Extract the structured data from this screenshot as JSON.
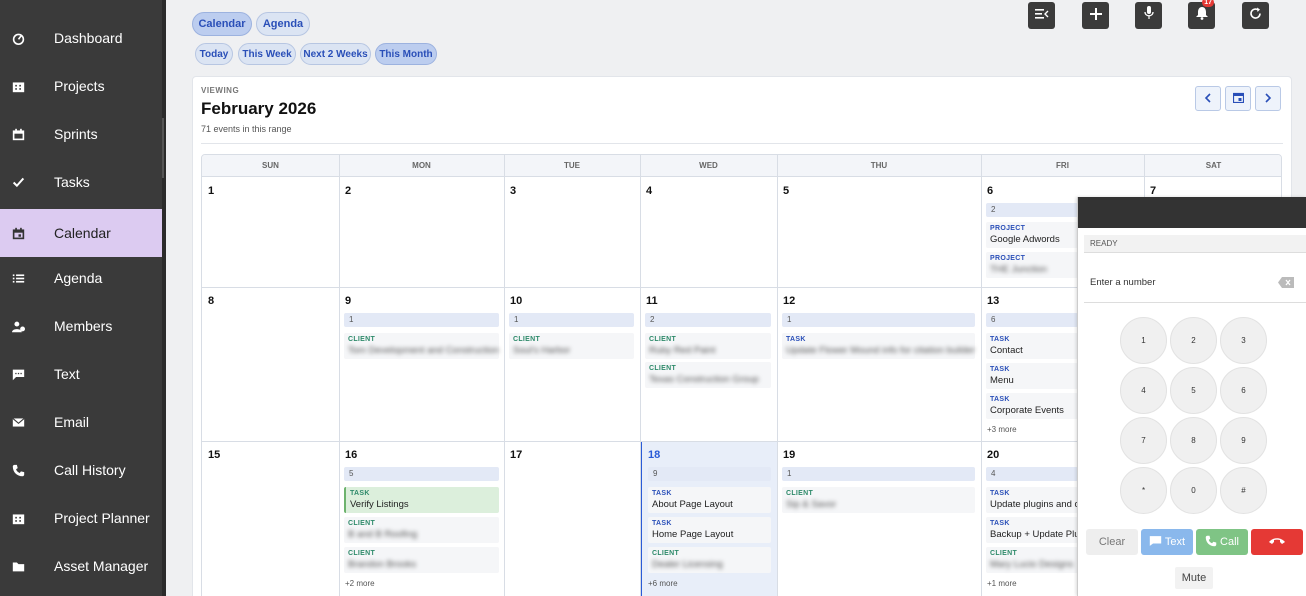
{
  "sidebar": {
    "items": [
      {
        "label": "Dashboard",
        "icon": "gauge-icon"
      },
      {
        "label": "Projects",
        "icon": "building-icon"
      },
      {
        "label": "Sprints",
        "icon": "calendar-icon"
      },
      {
        "label": "Tasks",
        "icon": "check-icon"
      },
      {
        "label": "Calendar",
        "icon": "calendar-day-icon",
        "active": true
      },
      {
        "label": "Agenda",
        "icon": "list-icon"
      },
      {
        "label": "Members",
        "icon": "members-icon"
      },
      {
        "label": "Text",
        "icon": "chat-icon"
      },
      {
        "label": "Email",
        "icon": "envelope-icon"
      },
      {
        "label": "Call History",
        "icon": "phone-icon"
      },
      {
        "label": "Project Planner",
        "icon": "building-icon"
      },
      {
        "label": "Asset Manager",
        "icon": "folder-icon"
      }
    ]
  },
  "view_tabs": {
    "calendar": "Calendar",
    "agenda": "Agenda"
  },
  "range_tabs": {
    "today": "Today",
    "this_week": "This Week",
    "next_2_weeks": "Next 2 Weeks",
    "this_month": "This Month"
  },
  "toolbar": {
    "notification_count": "17"
  },
  "header": {
    "viewing": "VIEWING",
    "month": "February 2026",
    "range": "71 events in this range"
  },
  "calendar": {
    "days_of_week": [
      "SUN",
      "MON",
      "TUE",
      "WED",
      "THU",
      "FRI",
      "SAT"
    ],
    "week1": {
      "d1": "1",
      "d2": "2",
      "d3": "3",
      "d4": "4",
      "d5": "5",
      "d6": "6",
      "d7": "7",
      "fri_count": "2",
      "fri_ev1_type": "PROJECT",
      "fri_ev1_name": "Google Adwords",
      "fri_ev2_type": "PROJECT",
      "fri_ev2_name": "THE Junction"
    },
    "week2": {
      "d1": "8",
      "d2": "9",
      "d3": "10",
      "d4": "11",
      "d5": "12",
      "d6": "13",
      "mon_count": "1",
      "mon_ev1_type": "CLIENT",
      "mon_ev1_name": "Tom Development and Construction",
      "tue_count": "1",
      "tue_ev1_type": "CLIENT",
      "tue_ev1_name": "Soul's Harbor",
      "wed_count": "2",
      "wed_ev1_type": "CLIENT",
      "wed_ev1_name": "Ruby Red Paint",
      "wed_ev2_type": "CLIENT",
      "wed_ev2_name": "Texas Construction Group",
      "thu_count": "1",
      "thu_ev1_type": "TASK",
      "thu_ev1_name": "Update Flower Mound info for citation builder",
      "fri_count": "6",
      "fri_ev1_type": "TASK",
      "fri_ev1_name": "Contact",
      "fri_ev2_type": "TASK",
      "fri_ev2_name": "Menu",
      "fri_ev3_type": "TASK",
      "fri_ev3_name": "Corporate Events",
      "fri_more": "+3 more"
    },
    "week3": {
      "d1": "15",
      "d2": "16",
      "d3": "17",
      "d4": "18",
      "d5": "19",
      "d6": "20",
      "mon_count": "5",
      "mon_ev1_type": "TASK",
      "mon_ev1_name": "Verify Listings",
      "mon_ev2_type": "CLIENT",
      "mon_ev2_name": "B and B Roofing",
      "mon_ev3_type": "CLIENT",
      "mon_ev3_name": "Brandon Brooks",
      "mon_more": "+2 more",
      "wed_count": "9",
      "wed_ev1_type": "TASK",
      "wed_ev1_name": "About Page Layout",
      "wed_ev2_type": "TASK",
      "wed_ev2_name": "Home Page Layout",
      "wed_ev3_type": "CLIENT",
      "wed_ev3_name": "Dealer Licensing",
      "wed_more": "+6 more",
      "thu_count": "1",
      "thu_ev1_type": "CLIENT",
      "thu_ev1_name": "Sip & Savor",
      "fri_count": "4",
      "fri_ev1_type": "TASK",
      "fri_ev1_name": "Update plugins and co",
      "fri_ev2_type": "TASK",
      "fri_ev2_name": "Backup + Update Plug",
      "fri_ev3_type": "CLIENT",
      "fri_ev3_name": "Mary Lucio Designs",
      "fri_more": "+1 more"
    }
  },
  "dialer": {
    "status": "READY",
    "placeholder": "Enter a number",
    "keys": [
      "1",
      "2",
      "3",
      "4",
      "5",
      "6",
      "7",
      "8",
      "9",
      "*",
      "0",
      "#"
    ],
    "clear": "Clear",
    "text": "Text",
    "call": "Call",
    "mute": "Mute",
    "colors": {
      "text_button": "#8ab8ec",
      "call_button": "#7fc485",
      "hangup_button": "#e53935"
    }
  }
}
